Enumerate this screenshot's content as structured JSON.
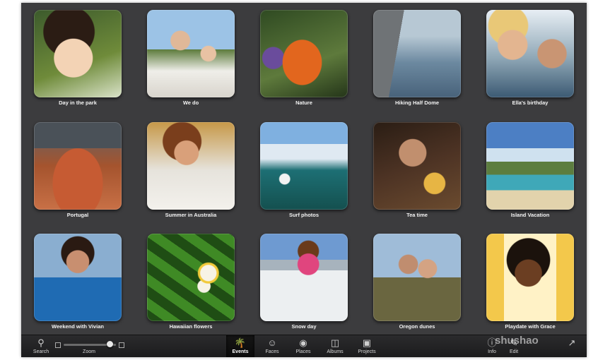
{
  "events": [
    {
      "caption": "Day in the park",
      "photo": "girl-with-flower"
    },
    {
      "caption": "We do",
      "photo": "wedding-couple"
    },
    {
      "caption": "Nature",
      "photo": "orange-butterfly"
    },
    {
      "caption": "Hiking Half Dome",
      "photo": "cliff-overlook"
    },
    {
      "caption": "Ella's birthday",
      "photo": "two-kids"
    },
    {
      "caption": "Portugal",
      "photo": "hillside-town"
    },
    {
      "caption": "Summer in Australia",
      "photo": "girl-with-koala-toy"
    },
    {
      "caption": "Surf photos",
      "photo": "surfer-wave"
    },
    {
      "caption": "Tea time",
      "photo": "woman-with-tea"
    },
    {
      "caption": "Island Vacation",
      "photo": "beach-cove"
    },
    {
      "caption": "Weekend with Vivian",
      "photo": "woman-by-harbor"
    },
    {
      "caption": "Hawaiian flowers",
      "photo": "plumeria-leaves"
    },
    {
      "caption": "Snow day",
      "photo": "girl-in-snow"
    },
    {
      "caption": "Oregon dunes",
      "photo": "two-girls-dunes"
    },
    {
      "caption": "Playdate with Grace",
      "photo": "girl-on-swing"
    }
  ],
  "toolbar": {
    "search": {
      "label": "Search",
      "icon": "magnifier-icon"
    },
    "zoom": {
      "label": "Zoom",
      "value": 0.88
    },
    "events": {
      "label": "Events",
      "icon": "palm-tree-icon"
    },
    "faces": {
      "label": "Faces",
      "icon": "face-icon"
    },
    "places": {
      "label": "Places",
      "icon": "globe-icon"
    },
    "albums": {
      "label": "Albums",
      "icon": "album-icon"
    },
    "projects": {
      "label": "Projects",
      "icon": "project-icon"
    },
    "info": {
      "label": "Info",
      "icon": "info-icon"
    },
    "edit": {
      "label": "Edit",
      "icon": "edit-icon"
    },
    "share": {
      "icon": "share-icon"
    }
  },
  "watermark": "shushao"
}
